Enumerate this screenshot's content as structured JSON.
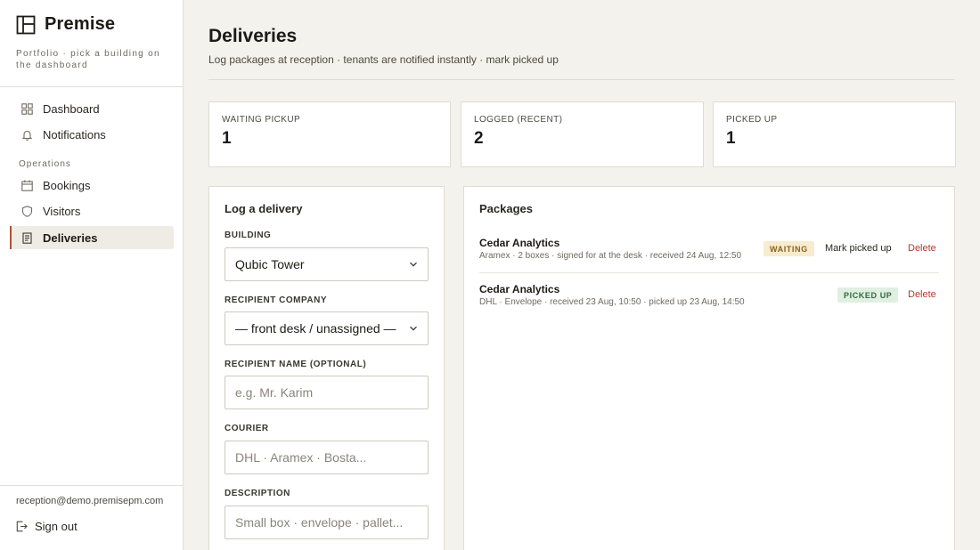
{
  "brand": {
    "name": "Premise",
    "subtitle": "Portfolio · pick a building on the dashboard"
  },
  "nav": {
    "items": [
      {
        "label": "Dashboard",
        "icon": "grid-icon"
      },
      {
        "label": "Notifications",
        "icon": "bell-icon"
      }
    ],
    "section_label": "Operations",
    "ops_items": [
      {
        "label": "Bookings",
        "icon": "calendar-icon"
      },
      {
        "label": "Visitors",
        "icon": "shield-icon"
      },
      {
        "label": "Deliveries",
        "icon": "clipboard-icon",
        "active": true
      }
    ]
  },
  "user": {
    "email": "reception@demo.premisepm.com",
    "signout_label": "Sign out"
  },
  "page": {
    "title": "Deliveries",
    "subtitle": "Log packages at reception · tenants are notified instantly · mark picked up"
  },
  "stats": [
    {
      "label": "WAITING PICKUP",
      "value": "1"
    },
    {
      "label": "LOGGED (RECENT)",
      "value": "2"
    },
    {
      "label": "PICKED UP",
      "value": "1"
    }
  ],
  "form": {
    "title": "Log a delivery",
    "building": {
      "label": "BUILDING",
      "value": "Qubic Tower"
    },
    "recipient_company": {
      "label": "RECIPIENT COMPANY",
      "value": "— front desk / unassigned —"
    },
    "recipient_name": {
      "label": "RECIPIENT NAME (OPTIONAL)",
      "placeholder": "e.g. Mr. Karim"
    },
    "courier": {
      "label": "COURIER",
      "placeholder": "DHL · Aramex · Bosta..."
    },
    "description": {
      "label": "DESCRIPTION",
      "placeholder": "Small box · envelope · pallet..."
    }
  },
  "packages": {
    "title": "Packages",
    "rows": [
      {
        "company": "Cedar Analytics",
        "meta": "Aramex · 2 boxes · signed for at the desk · received 24 Aug, 12:50",
        "status": "WAITING",
        "mark_label": "Mark picked up",
        "delete_label": "Delete"
      },
      {
        "company": "Cedar Analytics",
        "meta": "DHL · Envelope · received 23 Aug, 10:50 · picked up 23 Aug, 14:50",
        "status": "PICKED UP",
        "delete_label": "Delete"
      }
    ]
  },
  "colors": {
    "accent": "#b0512f",
    "background": "#f4f2ec",
    "waiting_badge": "#f7ecd0",
    "picked_badge": "#e1efe3",
    "delete": "#b23b2b"
  }
}
